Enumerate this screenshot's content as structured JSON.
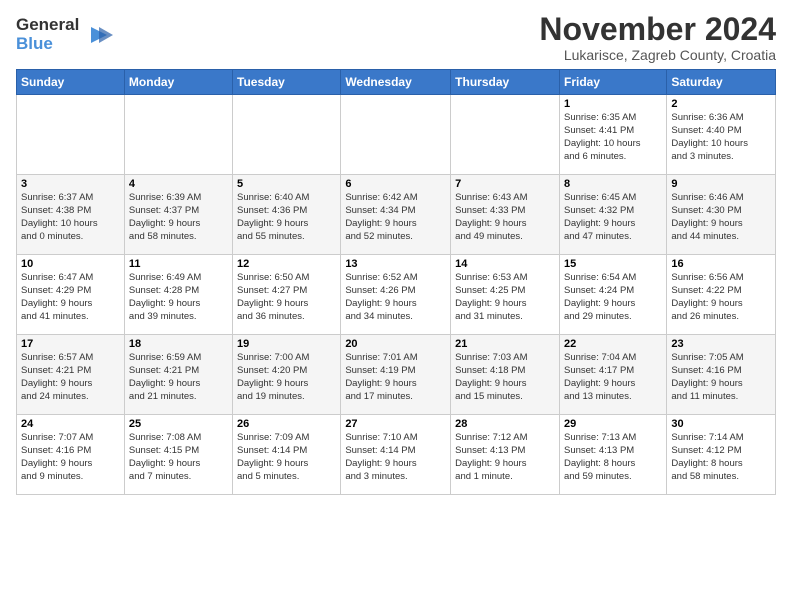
{
  "header": {
    "logo_line1": "General",
    "logo_line2": "Blue",
    "month": "November 2024",
    "location": "Lukarisce, Zagreb County, Croatia"
  },
  "weekdays": [
    "Sunday",
    "Monday",
    "Tuesday",
    "Wednesday",
    "Thursday",
    "Friday",
    "Saturday"
  ],
  "weeks": [
    [
      {
        "day": "",
        "info": ""
      },
      {
        "day": "",
        "info": ""
      },
      {
        "day": "",
        "info": ""
      },
      {
        "day": "",
        "info": ""
      },
      {
        "day": "",
        "info": ""
      },
      {
        "day": "1",
        "info": "Sunrise: 6:35 AM\nSunset: 4:41 PM\nDaylight: 10 hours\nand 6 minutes."
      },
      {
        "day": "2",
        "info": "Sunrise: 6:36 AM\nSunset: 4:40 PM\nDaylight: 10 hours\nand 3 minutes."
      }
    ],
    [
      {
        "day": "3",
        "info": "Sunrise: 6:37 AM\nSunset: 4:38 PM\nDaylight: 10 hours\nand 0 minutes."
      },
      {
        "day": "4",
        "info": "Sunrise: 6:39 AM\nSunset: 4:37 PM\nDaylight: 9 hours\nand 58 minutes."
      },
      {
        "day": "5",
        "info": "Sunrise: 6:40 AM\nSunset: 4:36 PM\nDaylight: 9 hours\nand 55 minutes."
      },
      {
        "day": "6",
        "info": "Sunrise: 6:42 AM\nSunset: 4:34 PM\nDaylight: 9 hours\nand 52 minutes."
      },
      {
        "day": "7",
        "info": "Sunrise: 6:43 AM\nSunset: 4:33 PM\nDaylight: 9 hours\nand 49 minutes."
      },
      {
        "day": "8",
        "info": "Sunrise: 6:45 AM\nSunset: 4:32 PM\nDaylight: 9 hours\nand 47 minutes."
      },
      {
        "day": "9",
        "info": "Sunrise: 6:46 AM\nSunset: 4:30 PM\nDaylight: 9 hours\nand 44 minutes."
      }
    ],
    [
      {
        "day": "10",
        "info": "Sunrise: 6:47 AM\nSunset: 4:29 PM\nDaylight: 9 hours\nand 41 minutes."
      },
      {
        "day": "11",
        "info": "Sunrise: 6:49 AM\nSunset: 4:28 PM\nDaylight: 9 hours\nand 39 minutes."
      },
      {
        "day": "12",
        "info": "Sunrise: 6:50 AM\nSunset: 4:27 PM\nDaylight: 9 hours\nand 36 minutes."
      },
      {
        "day": "13",
        "info": "Sunrise: 6:52 AM\nSunset: 4:26 PM\nDaylight: 9 hours\nand 34 minutes."
      },
      {
        "day": "14",
        "info": "Sunrise: 6:53 AM\nSunset: 4:25 PM\nDaylight: 9 hours\nand 31 minutes."
      },
      {
        "day": "15",
        "info": "Sunrise: 6:54 AM\nSunset: 4:24 PM\nDaylight: 9 hours\nand 29 minutes."
      },
      {
        "day": "16",
        "info": "Sunrise: 6:56 AM\nSunset: 4:22 PM\nDaylight: 9 hours\nand 26 minutes."
      }
    ],
    [
      {
        "day": "17",
        "info": "Sunrise: 6:57 AM\nSunset: 4:21 PM\nDaylight: 9 hours\nand 24 minutes."
      },
      {
        "day": "18",
        "info": "Sunrise: 6:59 AM\nSunset: 4:21 PM\nDaylight: 9 hours\nand 21 minutes."
      },
      {
        "day": "19",
        "info": "Sunrise: 7:00 AM\nSunset: 4:20 PM\nDaylight: 9 hours\nand 19 minutes."
      },
      {
        "day": "20",
        "info": "Sunrise: 7:01 AM\nSunset: 4:19 PM\nDaylight: 9 hours\nand 17 minutes."
      },
      {
        "day": "21",
        "info": "Sunrise: 7:03 AM\nSunset: 4:18 PM\nDaylight: 9 hours\nand 15 minutes."
      },
      {
        "day": "22",
        "info": "Sunrise: 7:04 AM\nSunset: 4:17 PM\nDaylight: 9 hours\nand 13 minutes."
      },
      {
        "day": "23",
        "info": "Sunrise: 7:05 AM\nSunset: 4:16 PM\nDaylight: 9 hours\nand 11 minutes."
      }
    ],
    [
      {
        "day": "24",
        "info": "Sunrise: 7:07 AM\nSunset: 4:16 PM\nDaylight: 9 hours\nand 9 minutes."
      },
      {
        "day": "25",
        "info": "Sunrise: 7:08 AM\nSunset: 4:15 PM\nDaylight: 9 hours\nand 7 minutes."
      },
      {
        "day": "26",
        "info": "Sunrise: 7:09 AM\nSunset: 4:14 PM\nDaylight: 9 hours\nand 5 minutes."
      },
      {
        "day": "27",
        "info": "Sunrise: 7:10 AM\nSunset: 4:14 PM\nDaylight: 9 hours\nand 3 minutes."
      },
      {
        "day": "28",
        "info": "Sunrise: 7:12 AM\nSunset: 4:13 PM\nDaylight: 9 hours\nand 1 minute."
      },
      {
        "day": "29",
        "info": "Sunrise: 7:13 AM\nSunset: 4:13 PM\nDaylight: 8 hours\nand 59 minutes."
      },
      {
        "day": "30",
        "info": "Sunrise: 7:14 AM\nSunset: 4:12 PM\nDaylight: 8 hours\nand 58 minutes."
      }
    ]
  ]
}
